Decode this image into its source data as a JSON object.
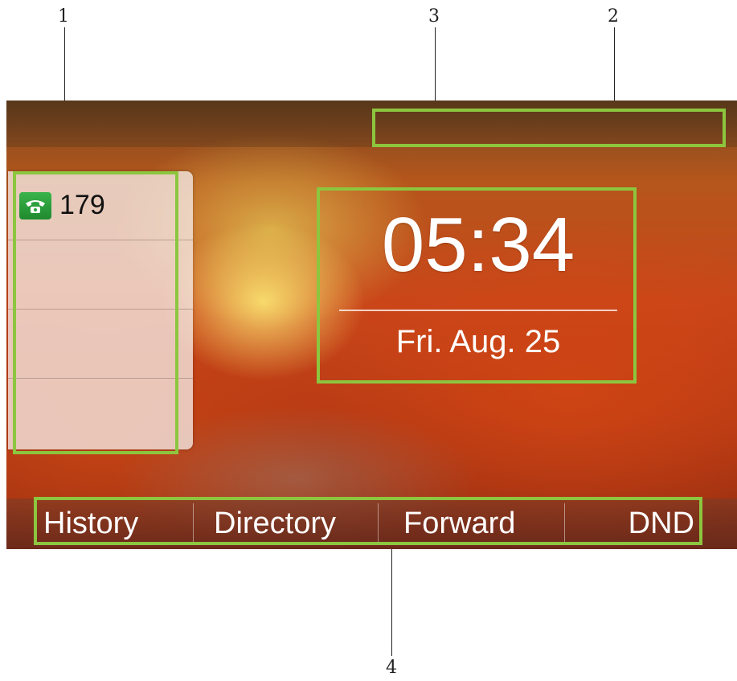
{
  "callouts": [
    "1",
    "2",
    "3",
    "4"
  ],
  "line_keys": [
    {
      "label": "179",
      "icon": "phone-icon",
      "status_color": "#2aa63b"
    },
    {
      "label": ""
    },
    {
      "label": ""
    },
    {
      "label": ""
    }
  ],
  "clock": {
    "time": "05:34",
    "date": "Fri. Aug. 25"
  },
  "softkeys": [
    "History",
    "Directory",
    "Forward",
    "DND"
  ],
  "colors": {
    "highlight": "#8cc63f",
    "text": "#ffffff"
  }
}
